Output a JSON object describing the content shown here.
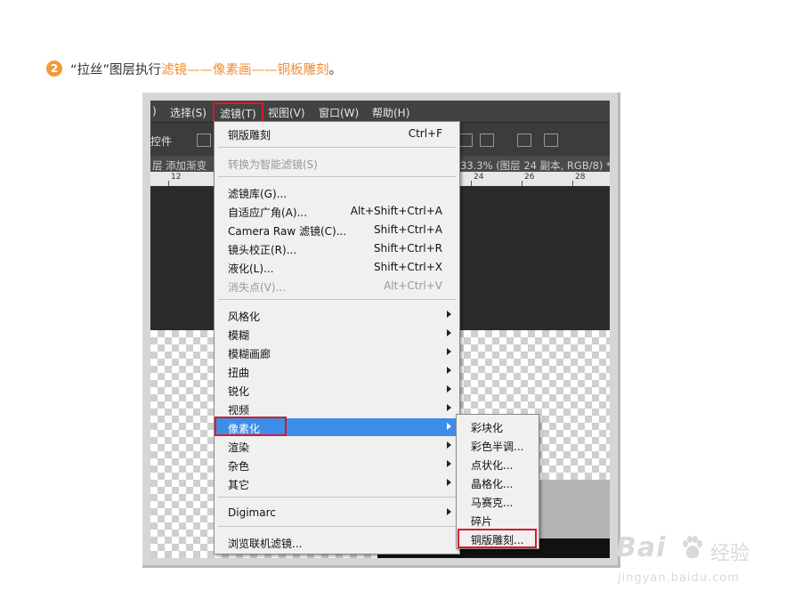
{
  "caption": {
    "step_number": "2",
    "text_before": "“拉丝”图层执行",
    "text_highlight": "滤镜——像素画——铜板雕刻",
    "text_after": "。"
  },
  "menubar": [
    {
      "label": ")"
    },
    {
      "label": "选择(S)"
    },
    {
      "label": "滤镜(T)",
      "active": true
    },
    {
      "label": "视图(V)"
    },
    {
      "label": "窗口(W)"
    },
    {
      "label": "帮助(H)"
    }
  ],
  "options_bar": {
    "left_text": "控件"
  },
  "doc_tab": {
    "left_text": "层 添加渐变",
    "right_text": "33.3% (图层 24 副本, RGB/8) *"
  },
  "ruler": [
    "12",
    "24",
    "26",
    "28"
  ],
  "filter_menu": {
    "last_filter": {
      "label": "铜版雕刻",
      "shortcut": "Ctrl+F"
    },
    "convert_smart": {
      "label": "转换为智能滤镜(S)"
    },
    "group1": [
      {
        "label": "滤镜库(G)...",
        "shortcut": ""
      },
      {
        "label": "自适应广角(A)...",
        "shortcut": "Alt+Shift+Ctrl+A"
      },
      {
        "label": "Camera Raw 滤镜(C)...",
        "shortcut": "Shift+Ctrl+A"
      },
      {
        "label": "镜头校正(R)...",
        "shortcut": "Shift+Ctrl+R"
      },
      {
        "label": "液化(L)...",
        "shortcut": "Shift+Ctrl+X"
      },
      {
        "label": "消失点(V)...",
        "shortcut": "Alt+Ctrl+V"
      }
    ],
    "group2": [
      {
        "label": "风格化"
      },
      {
        "label": "模糊"
      },
      {
        "label": "模糊画廊"
      },
      {
        "label": "扭曲"
      },
      {
        "label": "锐化"
      },
      {
        "label": "视频"
      },
      {
        "label": "像素化"
      },
      {
        "label": "渲染"
      },
      {
        "label": "杂色"
      },
      {
        "label": "其它"
      }
    ],
    "digimarc": {
      "label": "Digimarc"
    },
    "browse": {
      "label": "浏览联机滤镜..."
    }
  },
  "pixelate_submenu": [
    {
      "label": "彩块化"
    },
    {
      "label": "彩色半调..."
    },
    {
      "label": "点状化..."
    },
    {
      "label": "晶格化..."
    },
    {
      "label": "马赛克..."
    },
    {
      "label": "碎片"
    },
    {
      "label": "铜版雕刻..."
    }
  ],
  "watermark": {
    "brand": "Bai",
    "brand_cn": "经验",
    "url": "jingyan.baidu.com"
  },
  "colors": {
    "accent": "#f08c32",
    "highlight": "#3d8ee8",
    "callout": "#d9192b"
  }
}
